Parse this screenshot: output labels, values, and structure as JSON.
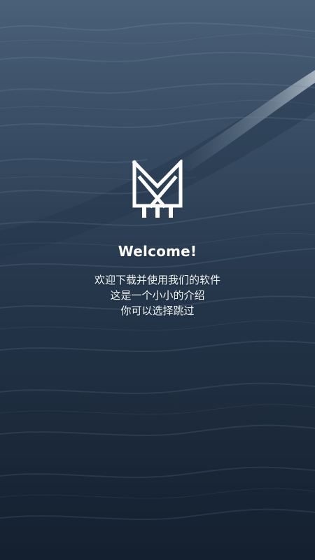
{
  "welcome": {
    "title": "Welcome!",
    "lines": [
      "欢迎下载并使用我们的软件",
      "这是一个小小的介绍",
      "你可以选择跳过"
    ]
  },
  "logo": {
    "icon": "brand-logo-icon"
  },
  "background": {
    "icon": "ocean-waves-background"
  }
}
